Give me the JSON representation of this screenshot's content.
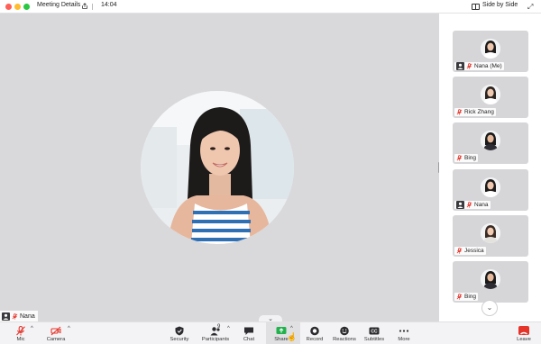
{
  "titlebar": {
    "title": "Meeting Details",
    "time": "14:04",
    "view_label": "Side by Side"
  },
  "stage": {
    "speaker_name": "Nana"
  },
  "gallery": [
    {
      "name": "Nana (Me)",
      "has_avatar_badge": true
    },
    {
      "name": "Rick Zhang",
      "has_avatar_badge": false
    },
    {
      "name": "Bing",
      "has_avatar_badge": false
    },
    {
      "name": "Nana",
      "has_avatar_badge": true
    },
    {
      "name": "Jessica",
      "has_avatar_badge": false
    },
    {
      "name": "Bing",
      "has_avatar_badge": false
    }
  ],
  "toolbar": {
    "mic": "Mic",
    "camera": "Camera",
    "security": "Security",
    "participants": "Participants",
    "participants_count": "9",
    "chat": "Chat",
    "share": "Share",
    "record": "Record",
    "reactions": "Reactions",
    "subtitles": "Subtitles",
    "more": "More",
    "leave": "Leave"
  },
  "colors": {
    "stage_bg": "#d9d9dc",
    "tile_bg": "#d6d6d9",
    "mic_off_red": "#e5352b",
    "share_green": "#22b14c",
    "leave_red": "#e5352b"
  }
}
